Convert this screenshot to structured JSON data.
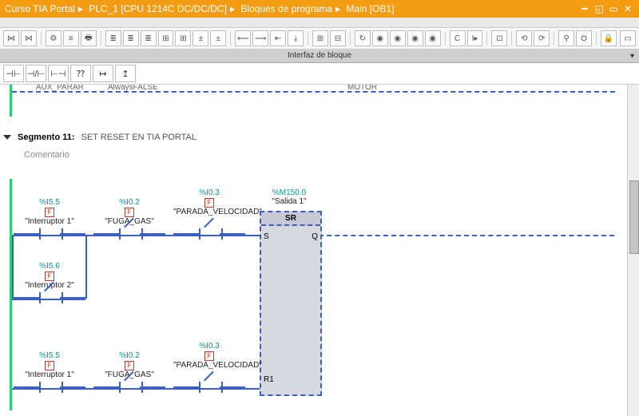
{
  "title": {
    "p1": "Curso TIA Portal",
    "p2": "PLC_1 [CPU 1214C DC/DC/DC]",
    "p3": "Bloques de programa",
    "p4": "Main [OB1]"
  },
  "iface": "Interfaz de bloque",
  "prev": {
    "left": "AUX_PARAR",
    "mid": "AlwaysFALSE",
    "right": "MOTOR"
  },
  "seg": {
    "num": "Segmento 11:",
    "title": "SET RESET EN TIA PORTAL",
    "comment": "Comentario"
  },
  "n": {
    "i1": {
      "a": "%I5.5",
      "n": "\"Interruptor 1\""
    },
    "i2": {
      "a": "%I5.6",
      "n": "\"Interruptor 2\""
    },
    "fg": {
      "a": "%I0.2",
      "n": "\"FUGA_GAS\""
    },
    "pv": {
      "a": "%I0.3",
      "n": "\"PARADA_VELOCIDAD\""
    },
    "out": {
      "a": "%M150.0",
      "n": "\"Salida 1\""
    }
  },
  "sr": {
    "t": "SR",
    "s": "S",
    "q": "Q",
    "r": "R1"
  },
  "flag": "F",
  "ladder_icons": [
    "⊣⊢",
    "⊣/⊢",
    "⊢⊣",
    "⁇",
    "↦",
    "↥"
  ]
}
